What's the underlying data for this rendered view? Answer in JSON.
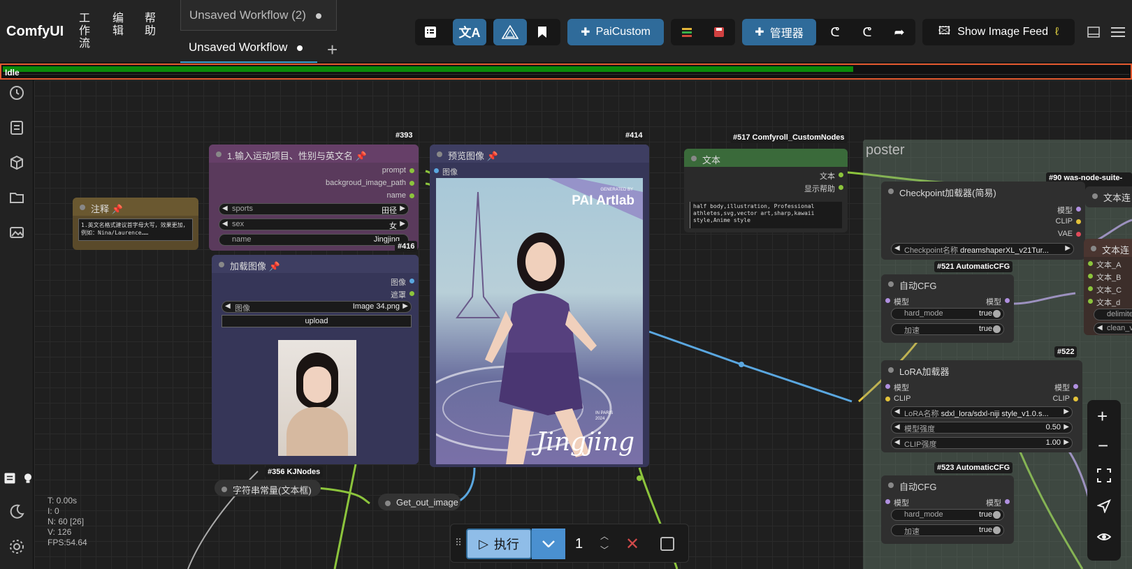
{
  "app": {
    "logo": "ComfyUI",
    "menu": [
      "工作流",
      "编辑",
      "帮助"
    ],
    "tabs": [
      {
        "label": "Unsaved Workflow (2)"
      },
      {
        "label": "Unsaved Workflow"
      }
    ],
    "toolbar": {
      "paicustom": "PaiCustom",
      "manager": "管理器",
      "show_image_feed": "Show Image Feed"
    }
  },
  "progress": {
    "label": "Idle",
    "fraction": 0.755
  },
  "stats": {
    "t": "T: 0.00s",
    "i": "I: 0",
    "n": "N: 60 [26]",
    "v": "V: 126",
    "fps": "FPS:54.64"
  },
  "nodes": {
    "n393": {
      "id": "#393",
      "title": "1.输入运动项目、性别与英文名",
      "outputs": [
        "prompt",
        "backgroud_image_path",
        "name"
      ],
      "widgets": [
        {
          "label": "sports",
          "value": "田径"
        },
        {
          "label": "sex",
          "value": "女"
        },
        {
          "label": "name",
          "value": "Jingjing"
        }
      ]
    },
    "note": {
      "title": "注释",
      "text": "1.英文名格式建议首字母大写，效果更加，例如：Nina/Laurence……"
    },
    "n416": {
      "id": "#416",
      "title": "加载图像",
      "outputs": [
        "图像",
        "遮罩"
      ],
      "widget": {
        "label": "图像",
        "value": "Image 34.png"
      },
      "upload": "upload"
    },
    "n414": {
      "id": "#414",
      "title": "预览图像",
      "input": "图像",
      "poster_brand": "PAI Artlab",
      "poster_generated": "GENERATED BY",
      "poster_name": "Jingjing",
      "poster_place": "IN PARIS",
      "poster_year": "2024"
    },
    "n517": {
      "id": "#517 Comfyroll_CustomNodes",
      "title": "文本",
      "outputs": [
        "文本",
        "显示帮助"
      ],
      "text": "half body,illustration, Professional athletes,svg,vector art,sharp,kawaii style,Anime style"
    },
    "group": {
      "title": "poster"
    },
    "n90": {
      "id": "#90 was-node-suite-co",
      "partial": "文本连"
    },
    "ckpt": {
      "title": "Checkpoint加载器(简易)",
      "outputs": [
        "模型",
        "CLIP",
        "VAE"
      ],
      "widget": {
        "label": "Checkpoint名称",
        "value": "dreamshaperXL_v21Tur..."
      }
    },
    "n521": {
      "id": "#521 AutomaticCFG",
      "title": "自动CFG",
      "input": "模型",
      "output": "模型",
      "widgets": [
        {
          "label": "hard_mode",
          "value": "true"
        },
        {
          "label": "加速",
          "value": "true"
        }
      ]
    },
    "concat": {
      "title": "文本连",
      "inputs": [
        "文本_A",
        "文本_B",
        "文本_C",
        "文本_d"
      ],
      "widgets": [
        "delimite",
        "clean_v"
      ]
    },
    "n522": {
      "id": "#522",
      "title": "LoRA加载器",
      "inputs": [
        "模型",
        "CLIP"
      ],
      "outputs": [
        "模型",
        "CLIP"
      ],
      "widgets": [
        {
          "label": "LoRA名称",
          "value": "sdxl_lora/sdxl-niji style_v1.0.s..."
        },
        {
          "label": "模型强度",
          "value": "0.50"
        },
        {
          "label": "CLIP强度",
          "value": "1.00"
        }
      ]
    },
    "n523": {
      "id": "#523 AutomaticCFG",
      "title": "自动CFG",
      "input": "模型",
      "output": "模型",
      "widgets": [
        {
          "label": "hard_mode",
          "value": "true"
        },
        {
          "label": "加速",
          "value": "true"
        }
      ]
    },
    "n356": {
      "id": "#356 KJNodes",
      "title": "字符串常量(文本框)"
    },
    "getout": {
      "title": "Get_out_image"
    }
  },
  "runbar": {
    "run": "执行",
    "count": "1"
  },
  "colors": {
    "accent": "#2f6b9a",
    "progress": "#0a8a0a",
    "highlight": "#e2582e"
  }
}
